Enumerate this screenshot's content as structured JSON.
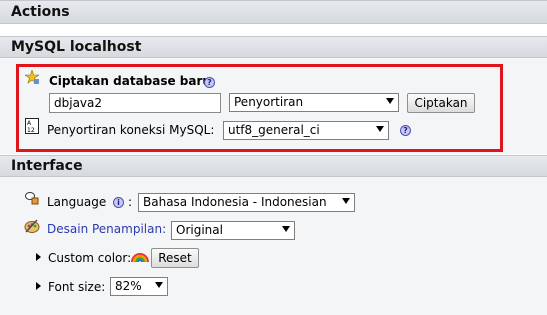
{
  "actions_header": "Actions",
  "mysql": {
    "header": "MySQL localhost",
    "create_db_title": "Ciptakan database baru",
    "db_name_value": "dbjava2",
    "collation_select_value": "Penyortiran",
    "create_button": "Ciptakan",
    "connection_collation_label": "Penyortiran koneksi MySQL:",
    "connection_collation_value": "utf8_general_ci"
  },
  "interface": {
    "header": "Interface",
    "language_label": "Language",
    "language_colon": ":",
    "language_value": "Bahasa Indonesia - Indonesian",
    "theme_label": "Desain Penampilan",
    "theme_colon": ":",
    "theme_value": "Original",
    "custom_color_label": "Custom color:",
    "reset_button": "Reset",
    "font_size_label": "Font size:",
    "font_size_value": "82%"
  },
  "icons": {
    "help": "?",
    "info": "i"
  },
  "colors": {
    "highlight_border": "#e0141b",
    "link": "#2b3ab0",
    "header_bg": "#d9dde2"
  }
}
